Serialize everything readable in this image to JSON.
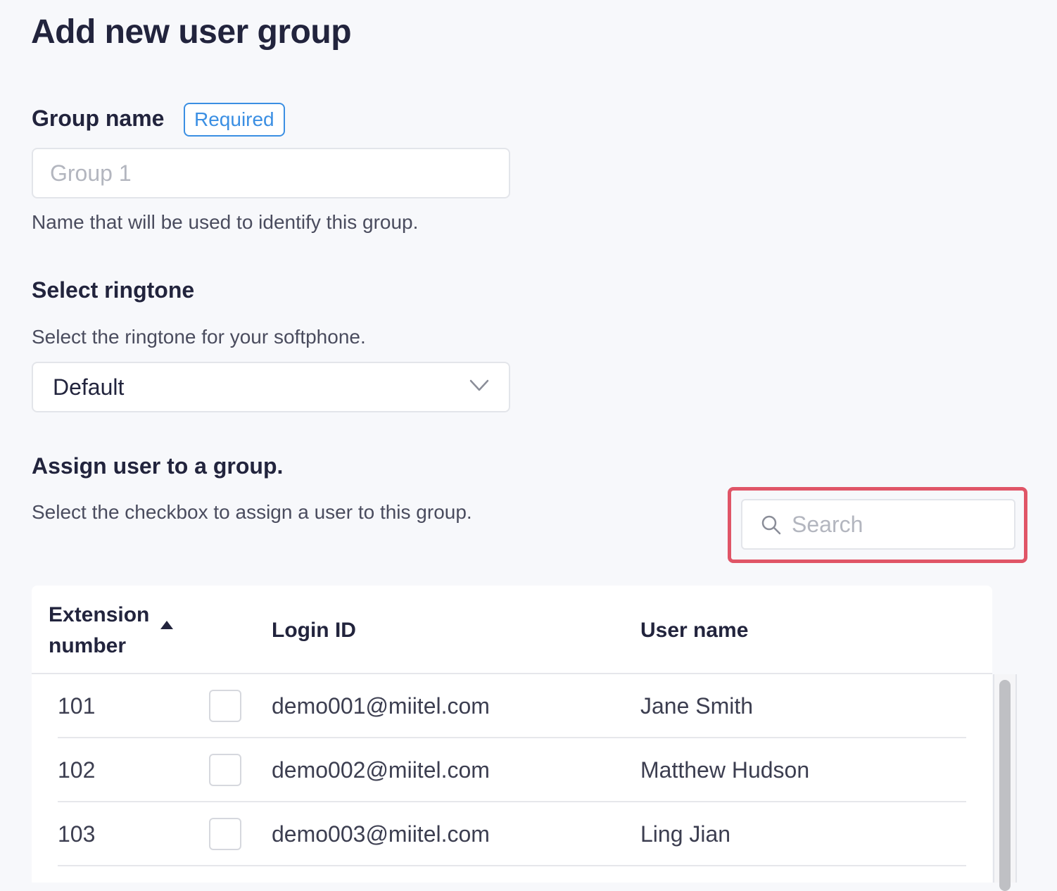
{
  "page": {
    "title": "Add new user group"
  },
  "group_name": {
    "label": "Group name",
    "badge": "Required",
    "placeholder": "Group 1",
    "value": "",
    "help": "Name that will be used to identify this group."
  },
  "ringtone": {
    "label": "Select ringtone",
    "help": "Select the ringtone for your softphone.",
    "selected": "Default"
  },
  "assign": {
    "label": "Assign user to a group.",
    "help": "Select the checkbox to assign a user to this group.",
    "search_placeholder": "Search"
  },
  "table": {
    "columns": {
      "extension_line1": "Extension",
      "extension_line2": "number",
      "login_id": "Login ID",
      "user_name": "User name"
    },
    "sort": {
      "column": "extension",
      "direction": "ascending"
    },
    "rows": [
      {
        "extension": "101",
        "login_id": "demo001@miitel.com",
        "user_name": "Jane Smith",
        "checked": false
      },
      {
        "extension": "102",
        "login_id": "demo002@miitel.com",
        "user_name": "Matthew Hudson",
        "checked": false
      },
      {
        "extension": "103",
        "login_id": "demo003@miitel.com",
        "user_name": "Ling Jian",
        "checked": false
      }
    ]
  },
  "colors": {
    "accent": "#3b8fe3",
    "highlight": "#e05567",
    "title": "#22243d",
    "background": "#f7f8fb"
  }
}
